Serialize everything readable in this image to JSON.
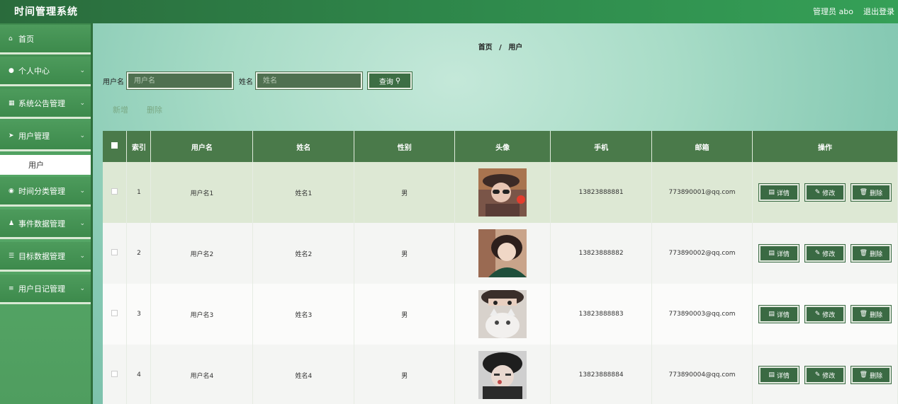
{
  "app": {
    "title": "时间管理系统"
  },
  "topbar": {
    "user": "管理员 abo",
    "logout": "退出登录"
  },
  "sidebar": {
    "items": [
      {
        "label": "首页",
        "icon": "home-icon",
        "has_chevron": false
      },
      {
        "label": "个人中心",
        "icon": "user-icon",
        "has_chevron": true
      },
      {
        "label": "系统公告管理",
        "icon": "grid-icon",
        "has_chevron": true
      },
      {
        "label": "用户管理",
        "icon": "send-icon",
        "has_chevron": true
      },
      {
        "label": "时间分类管理",
        "icon": "pin-icon",
        "has_chevron": true
      },
      {
        "label": "事件数据管理",
        "icon": "person-icon",
        "has_chevron": true
      },
      {
        "label": "目标数据管理",
        "icon": "list-icon",
        "has_chevron": true
      },
      {
        "label": "用户日记管理",
        "icon": "sliders-icon",
        "has_chevron": true
      }
    ],
    "sub_item": "用户"
  },
  "breadcrumb": {
    "home": "首页",
    "separator": "/",
    "current": "用户"
  },
  "search": {
    "username_label": "用户名",
    "username_placeholder": "用户名",
    "name_label": "姓名",
    "name_placeholder": "姓名",
    "button": "查询"
  },
  "actions": {
    "add": "新增",
    "delete": "删除"
  },
  "table": {
    "headers": [
      "索引",
      "用户名",
      "姓名",
      "性别",
      "头像",
      "手机",
      "邮箱",
      "操作"
    ],
    "rows": [
      {
        "index": "1",
        "username": "用户名1",
        "name": "姓名1",
        "gender": "男",
        "phone": "13823888881",
        "email": "773890001@qq.com"
      },
      {
        "index": "2",
        "username": "用户名2",
        "name": "姓名2",
        "gender": "男",
        "phone": "13823888882",
        "email": "773890002@qq.com"
      },
      {
        "index": "3",
        "username": "用户名3",
        "name": "姓名3",
        "gender": "男",
        "phone": "13823888883",
        "email": "773890003@qq.com"
      },
      {
        "index": "4",
        "username": "用户名4",
        "name": "姓名4",
        "gender": "男",
        "phone": "13823888884",
        "email": "773890004@qq.com"
      }
    ],
    "op_labels": {
      "detail": "详情",
      "edit": "修改",
      "delete": "删除"
    }
  },
  "colors": {
    "topbar": "#2f8a4c",
    "sidebar": "#4d9b5c",
    "header": "#4a7a4a",
    "button": "#3a6a43"
  }
}
